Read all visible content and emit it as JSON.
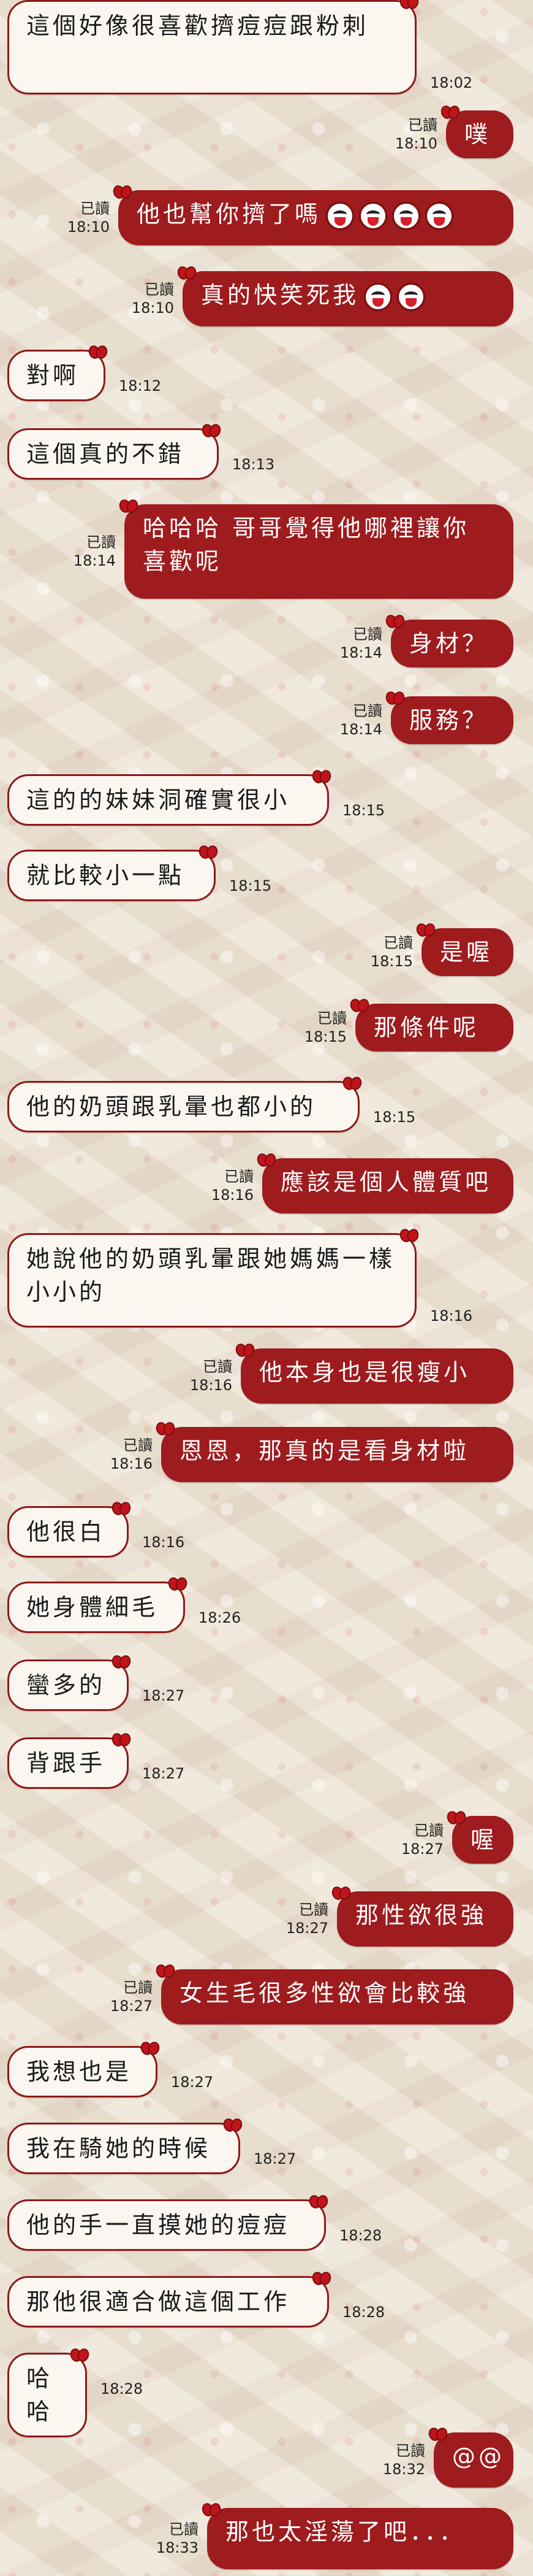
{
  "chat": {
    "messages": [
      {
        "side": "in",
        "text": "這個好像很喜歡擠痘痘跟粉刺",
        "time": "18:02"
      },
      {
        "side": "out",
        "text": "噗",
        "read": "已讀",
        "time": "18:10"
      },
      {
        "side": "out",
        "text": "他也幫你擠了嗎",
        "read": "已讀",
        "time": "18:10",
        "emoji_count": 4,
        "emoji_icon": "laughing-face-icon"
      },
      {
        "side": "out",
        "text": "真的快笑死我",
        "read": "已讀",
        "time": "18:10",
        "emoji_count": 2,
        "emoji_icon": "laughing-face-icon"
      },
      {
        "side": "in",
        "text": "對啊",
        "time": "18:12"
      },
      {
        "side": "in",
        "text": "這個真的不錯",
        "time": "18:13"
      },
      {
        "side": "out",
        "text": "哈哈哈 哥哥覺得他哪裡讓你喜歡呢",
        "read": "已讀",
        "time": "18:14"
      },
      {
        "side": "out",
        "text": "身材？",
        "read": "已讀",
        "time": "18:14"
      },
      {
        "side": "out",
        "text": "服務？",
        "read": "已讀",
        "time": "18:14"
      },
      {
        "side": "in",
        "text": "這的的妹妹洞確實很小",
        "time": "18:15"
      },
      {
        "side": "in",
        "text": "就比較小一點",
        "time": "18:15"
      },
      {
        "side": "out",
        "text": "是喔",
        "read": "已讀",
        "time": "18:15"
      },
      {
        "side": "out",
        "text": "那條件呢",
        "read": "已讀",
        "time": "18:15"
      },
      {
        "side": "in",
        "text": "他的奶頭跟乳暈也都小的",
        "time": "18:15"
      },
      {
        "side": "out",
        "text": "應該是個人體質吧",
        "read": "已讀",
        "time": "18:16"
      },
      {
        "side": "in",
        "text": "她說他的奶頭乳暈跟她媽媽一樣小小的",
        "time": "18:16"
      },
      {
        "side": "out",
        "text": "他本身也是很瘦小",
        "read": "已讀",
        "time": "18:16"
      },
      {
        "side": "out",
        "text": "恩恩，那真的是看身材啦",
        "read": "已讀",
        "time": "18:16"
      },
      {
        "side": "in",
        "text": "他很白",
        "time": "18:16"
      },
      {
        "side": "in",
        "text": "她身體細毛",
        "time": "18:26"
      },
      {
        "side": "in",
        "text": "蠻多的",
        "time": "18:27"
      },
      {
        "side": "in",
        "text": "背跟手",
        "time": "18:27"
      },
      {
        "side": "out",
        "text": "喔",
        "read": "已讀",
        "time": "18:27"
      },
      {
        "side": "out",
        "text": "那性欲很強",
        "read": "已讀",
        "time": "18:27"
      },
      {
        "side": "out",
        "text": "女生毛很多性欲會比較強",
        "read": "已讀",
        "time": "18:27"
      },
      {
        "side": "in",
        "text": "我想也是",
        "time": "18:27"
      },
      {
        "side": "in",
        "text": "我在騎她的時候",
        "time": "18:27"
      },
      {
        "side": "in",
        "text": "他的手一直摸她的痘痘",
        "time": "18:28"
      },
      {
        "side": "in",
        "text": "那他很適合做這個工作",
        "time": "18:28"
      },
      {
        "side": "in",
        "text": "哈哈",
        "time": "18:28"
      },
      {
        "side": "out",
        "text": "@@",
        "read": "已讀",
        "time": "18:32"
      },
      {
        "side": "out",
        "text": "那也太淫蕩了吧．．．",
        "read": "已讀",
        "time": "18:33"
      }
    ]
  },
  "colors": {
    "incoming_bubble": "#fbf7f0",
    "outgoing_bubble": "#9e1b1e",
    "bubble_border": "#8c1a1a",
    "bow": "#c0141b"
  }
}
